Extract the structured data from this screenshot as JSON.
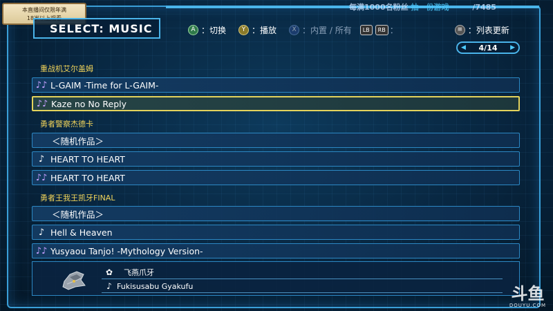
{
  "stream": {
    "badge_line1": "本直播间仅限年满",
    "badge_line2": "18岁以上观看",
    "overlay_left": "每满1000名粉丝",
    "overlay_mid": "抽一份游戏",
    "overlay_right": "/7485"
  },
  "header": {
    "title": "SELECT: MUSIC"
  },
  "help": {
    "a_glyph": "A",
    "a_label": "：切换",
    "y_glyph": "Y",
    "y_label": "：播放",
    "x_glyph": "X",
    "x_label": "：内置 / 所有",
    "lb": "LB",
    "rb": "RB",
    "lbrb_label": "：",
    "menu_glyph": "≡",
    "menu_label": "：列表更新"
  },
  "pager": {
    "left_arrow": "◀",
    "text": "4/14",
    "right_arrow": "▶"
  },
  "groups": [
    {
      "label": "重战机艾尔盖姆"
    },
    {
      "label": "勇者警察杰德卡"
    },
    {
      "label": "勇者王我王凯牙FINAL"
    }
  ],
  "rows": [
    {
      "icon": "♪♪",
      "title": "L-GAIM -Time for L-GAIM-"
    },
    {
      "icon": "♪♪",
      "title": "Kaze no No Reply"
    },
    {
      "icon": "",
      "title": "＜随机作品＞"
    },
    {
      "icon": "♪",
      "title": "HEART TO HEART"
    },
    {
      "icon": "♪♪",
      "title": "HEART TO HEART"
    },
    {
      "icon": "",
      "title": "＜随机作品＞"
    },
    {
      "icon": "♪",
      "title": "Hell & Heaven"
    },
    {
      "icon": "♪♪",
      "title": "Yusyaou Tanjo! -Mythology Version-"
    }
  ],
  "detail": {
    "skill_icon": "✿",
    "skill_name": "飞燕爪牙",
    "music_icon": "♪",
    "music_name": "Fukisusabu Gyakufu"
  },
  "watermark": {
    "big": "斗鱼",
    "small": "DOUYU.COM"
  },
  "colors": {
    "accent": "#4ab4ea",
    "group_label": "#f0d35a",
    "selected_border": "#e4d35c"
  }
}
